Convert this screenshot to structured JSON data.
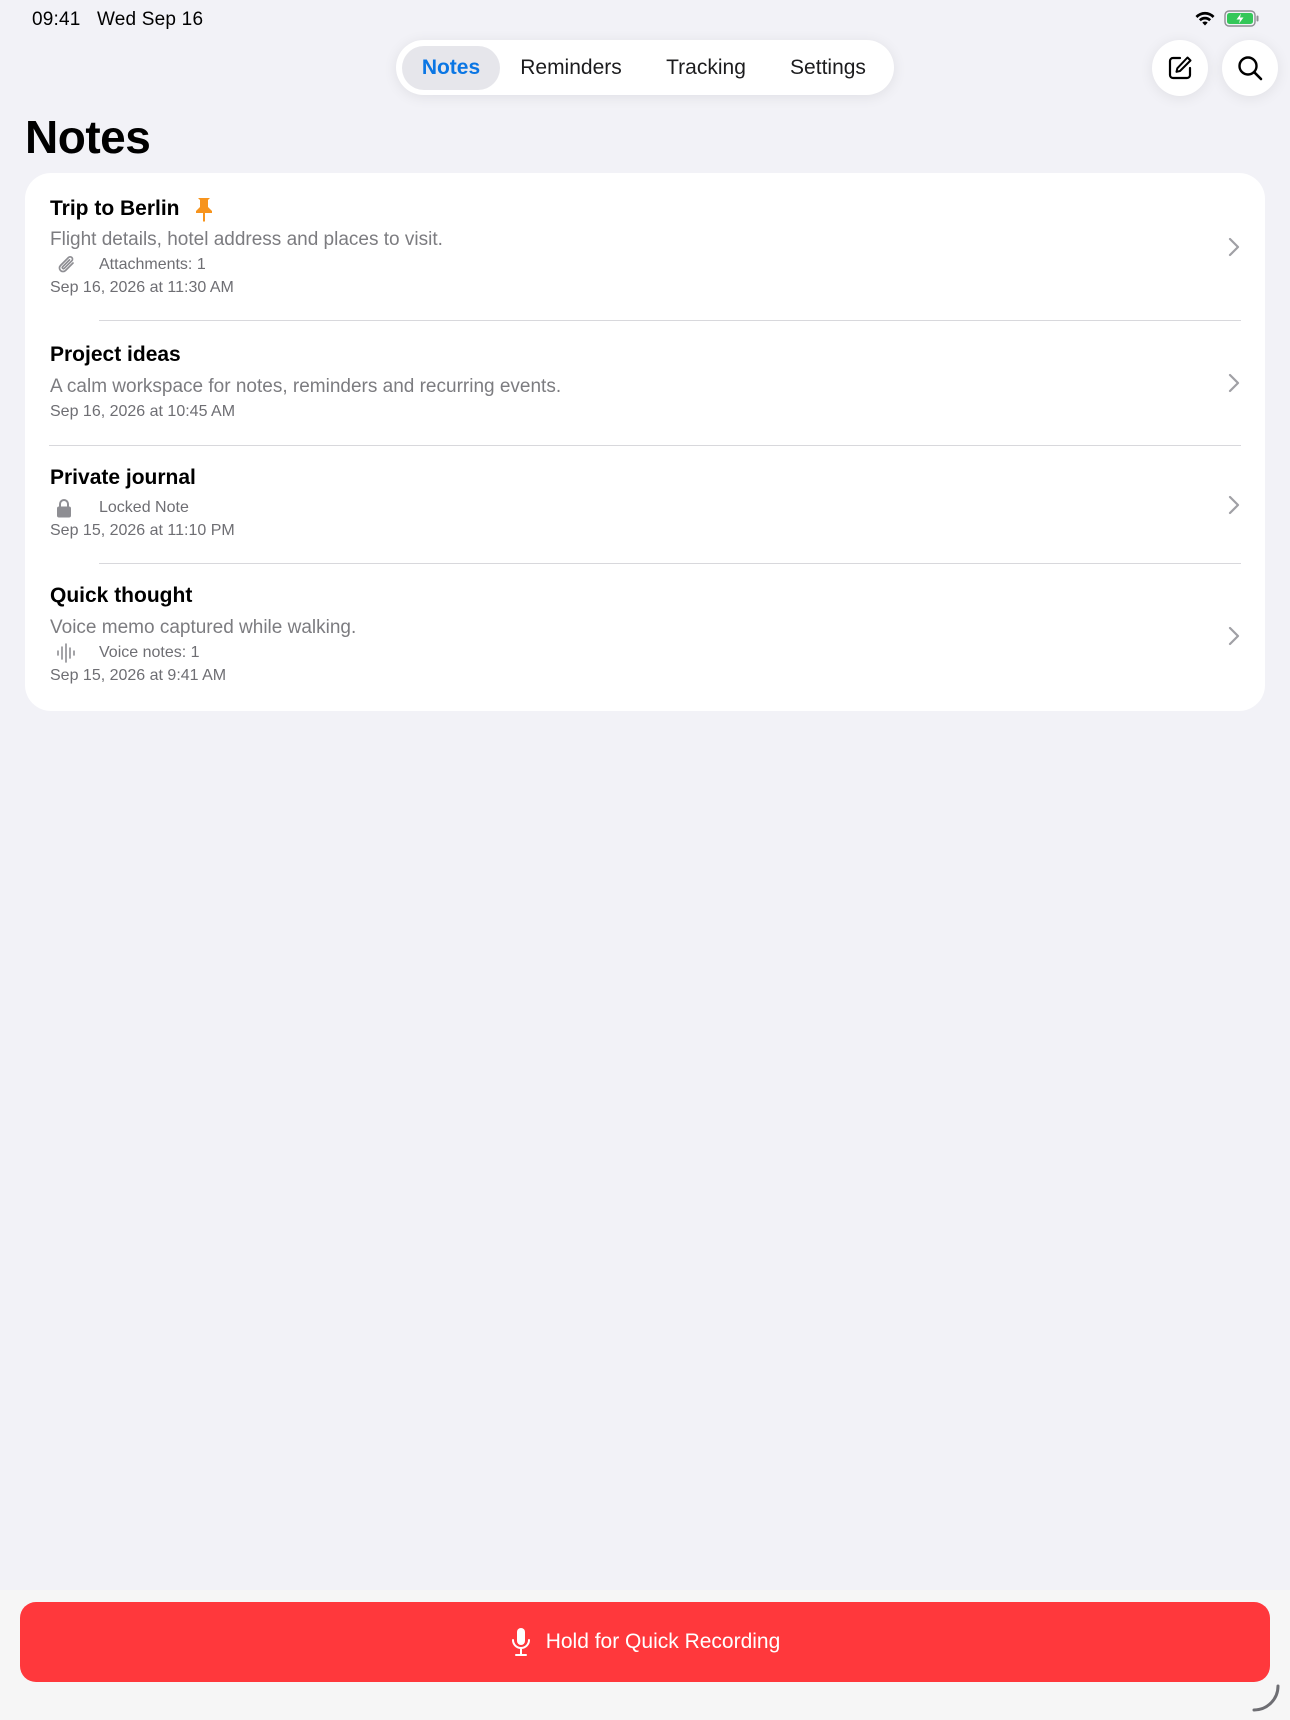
{
  "status_bar": {
    "time": "09:41",
    "date": "Wed Sep 16"
  },
  "tabs": [
    {
      "label": "Notes",
      "active": true
    },
    {
      "label": "Reminders",
      "active": false
    },
    {
      "label": "Tracking",
      "active": false
    },
    {
      "label": "Settings",
      "active": false
    }
  ],
  "actions": {
    "compose_icon": "compose-icon",
    "search_icon": "search-icon"
  },
  "page_title": "Notes",
  "notes": [
    {
      "title": "Trip to Berlin",
      "pinned": true,
      "preview": "Flight details, hotel address and places to visit.",
      "meta_icon": "paperclip-icon",
      "meta_text": "Attachments: 1",
      "date": "Sep 16, 2026 at 11:30 AM"
    },
    {
      "title": "Project ideas",
      "preview": "A calm workspace for notes, reminders and recurring events.",
      "date": "Sep 16, 2026 at 10:45 AM"
    },
    {
      "title": "Private journal",
      "meta_icon": "lock-icon",
      "meta_text": "Locked Note",
      "date": "Sep 15, 2026 at 11:10 PM"
    },
    {
      "title": "Quick thought",
      "preview": "Voice memo captured while walking.",
      "meta_icon": "waveform-icon",
      "meta_text": "Voice notes: 1",
      "date": "Sep 15, 2026 at 9:41 AM"
    }
  ],
  "quick_record": {
    "label": "Hold for Quick Recording",
    "icon": "microphone-icon"
  },
  "colors": {
    "accent": "#0a76e4",
    "pin": "#f7941d",
    "record": "#ff383c",
    "background": "#f2f2f7"
  }
}
